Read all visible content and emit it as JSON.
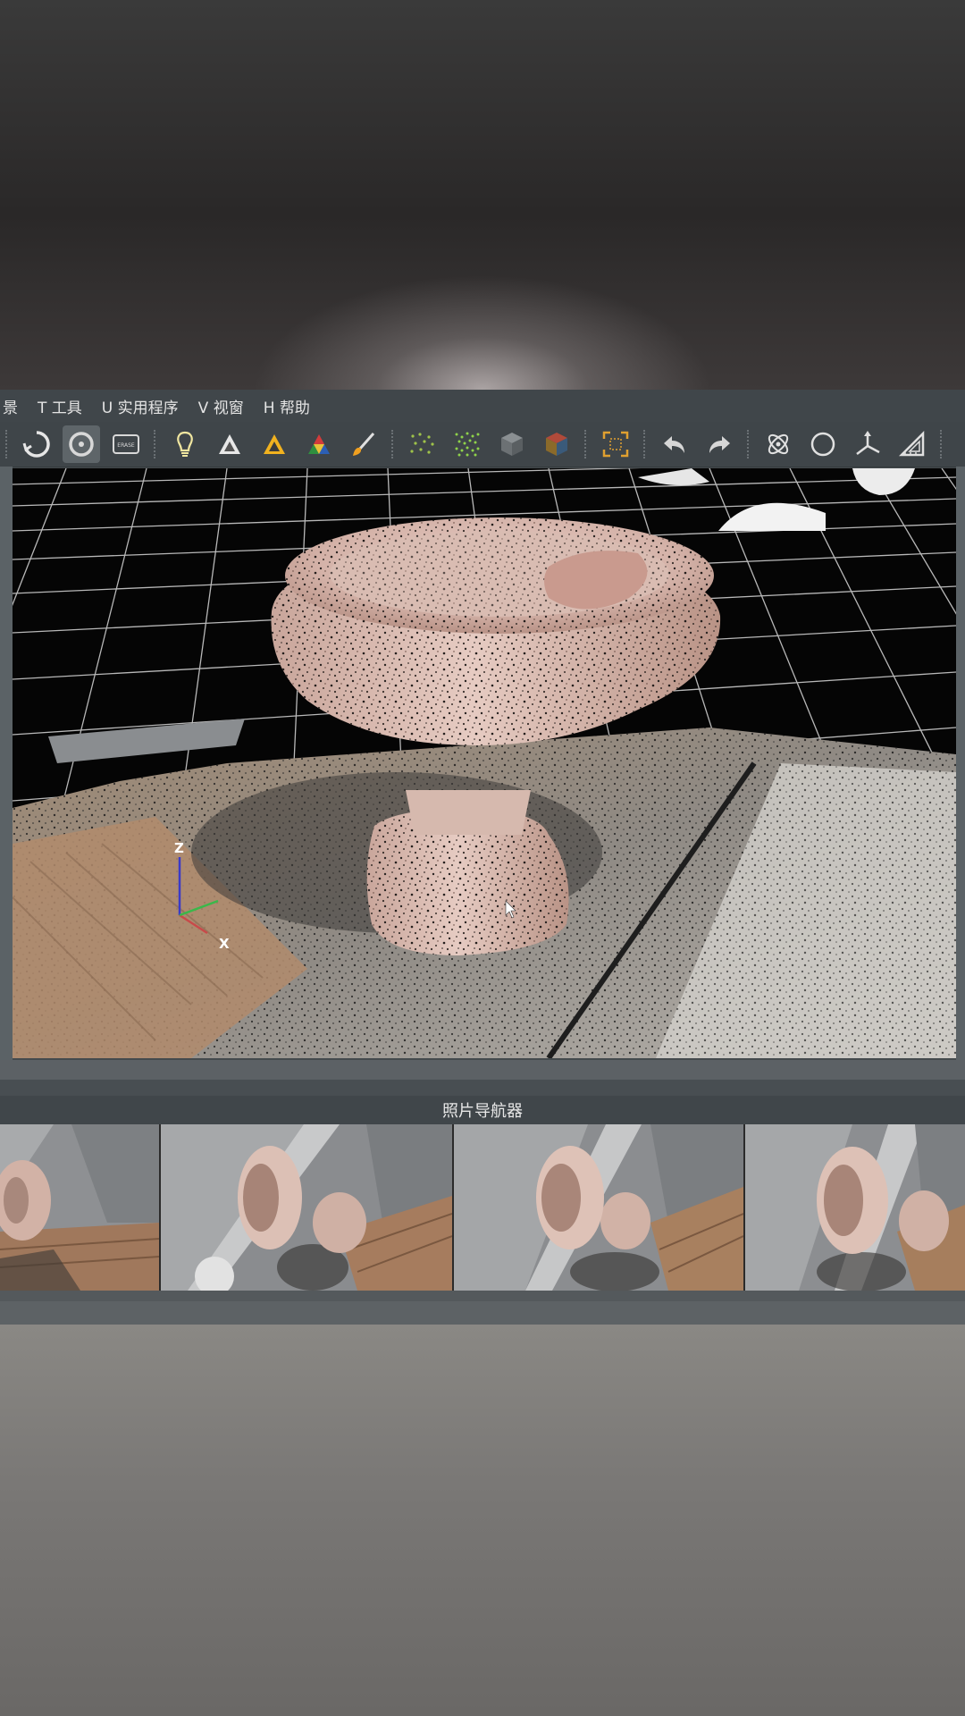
{
  "menubar": {
    "items": [
      {
        "label": "景"
      },
      {
        "label": "T 工具"
      },
      {
        "label": "U 实用程序"
      },
      {
        "label": "V 视窗"
      },
      {
        "label": "H 帮助"
      }
    ]
  },
  "toolbar": {
    "tools": [
      {
        "name": "rotate-orbit-icon",
        "active": false
      },
      {
        "name": "rotate-target-icon",
        "active": true
      },
      {
        "name": "erase-icon",
        "label": "ERASE",
        "active": false
      },
      {
        "name": "light-bulb-icon",
        "active": false
      },
      {
        "name": "mesh-white-icon",
        "active": false
      },
      {
        "name": "mesh-yellow-icon",
        "active": false
      },
      {
        "name": "mesh-color-icon",
        "active": false
      },
      {
        "name": "paint-brush-icon",
        "active": false
      },
      {
        "name": "sparse-points-icon",
        "active": false
      },
      {
        "name": "dense-points-icon",
        "active": false
      },
      {
        "name": "cube-icon",
        "active": false
      },
      {
        "name": "textured-cube-icon",
        "active": false
      },
      {
        "name": "selection-frame-icon",
        "active": false
      },
      {
        "name": "undo-icon",
        "active": false
      },
      {
        "name": "redo-icon",
        "active": false
      },
      {
        "name": "orbit-atom-icon",
        "active": false
      },
      {
        "name": "circle-icon",
        "active": false
      },
      {
        "name": "axis-transform-icon",
        "active": false
      },
      {
        "name": "ruler-triangle-icon",
        "active": false
      }
    ]
  },
  "viewport": {
    "axis_z": "Z",
    "axis_x": "X"
  },
  "photo_navigator": {
    "title": "照片导航器"
  }
}
